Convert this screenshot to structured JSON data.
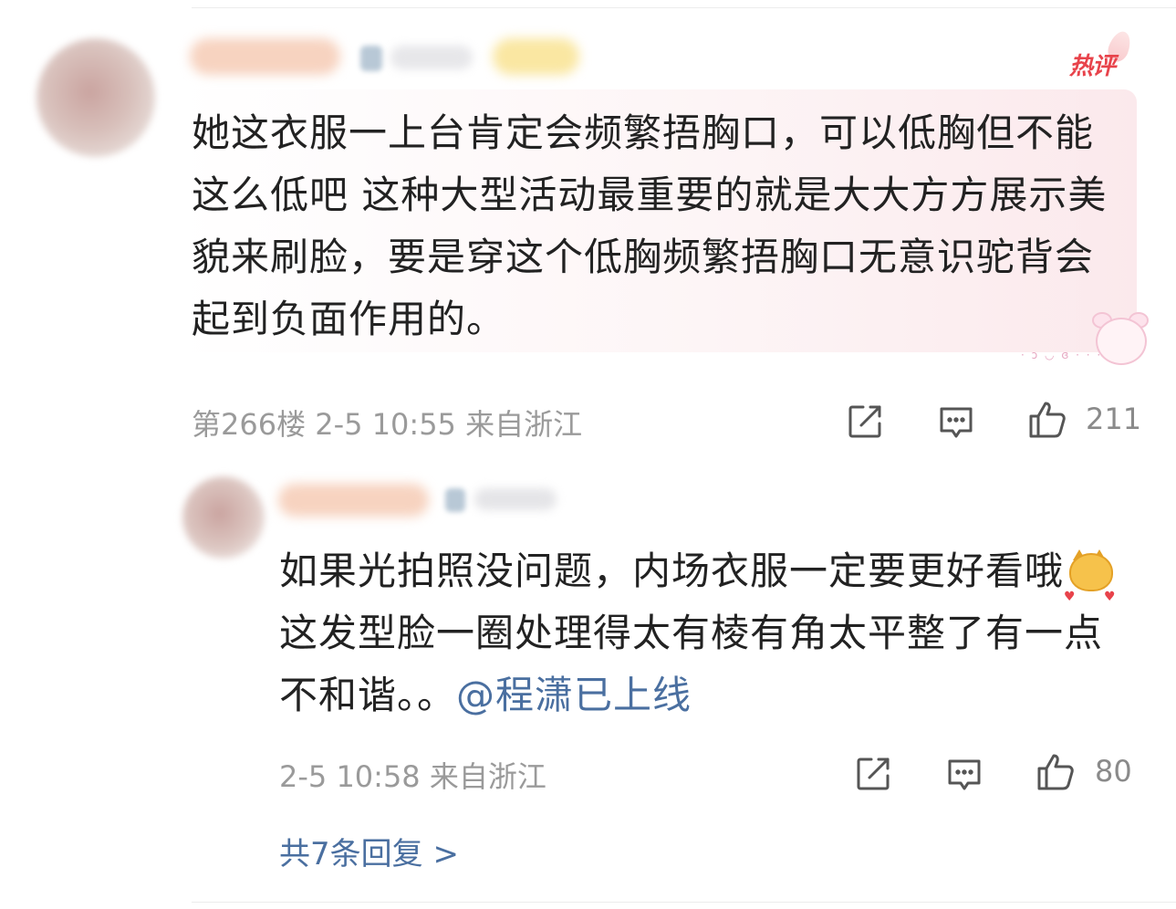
{
  "comment": {
    "hot_tag": "热评",
    "text": "她这衣服一上台肯定会频繁捂胸口，可以低胸但不能这么低吧 这种大型活动最重要的就是大大方方展示美貌来刷脸，要是穿这个低胸频繁捂胸口无意识驼背会起到负面作用的。",
    "meta": "第266楼 2-5 10:55 来自浙江",
    "like_count": "211",
    "icons": {
      "share": "share-icon",
      "comment": "comment-icon",
      "like": "thumbs-up-icon"
    }
  },
  "reply": {
    "text_part1": "如果光拍照没问题，内场衣服一定要更好看哦",
    "emoji": "cat-heart-emoji",
    "text_part2": "这发型脸一圈处理得太有棱有角太平整了有一点不和谐。。",
    "mention": "@程潇已上线",
    "meta": "2-5 10:58 来自浙江",
    "like_count": "80"
  },
  "replies_link": "共7条回复 >",
  "colors": {
    "hot": "#e8434b",
    "link": "#4a6fa0",
    "meta": "#9a9a9a",
    "text": "#222222"
  }
}
